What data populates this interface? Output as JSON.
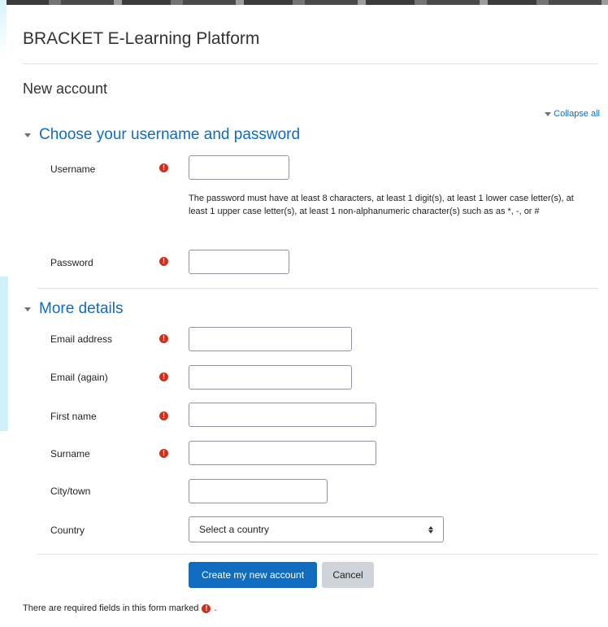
{
  "site": {
    "title": "BRACKET E-Learning Platform"
  },
  "page": {
    "heading": "New account"
  },
  "form": {
    "collapse_all": "Collapse all",
    "section_username": {
      "title": "Choose your username and password",
      "username_label": "Username",
      "password_help": "The password must have at least 8 characters, at least 1 digit(s), at least 1 lower case letter(s), at least 1 upper case letter(s), at least 1 non-alphanumeric character(s) such as as *, -, or #",
      "password_label": "Password"
    },
    "section_details": {
      "title": "More details",
      "email_label": "Email address",
      "email2_label": "Email (again)",
      "firstname_label": "First name",
      "surname_label": "Surname",
      "city_label": "City/town",
      "country_label": "Country",
      "country_selected": "Select a country"
    },
    "buttons": {
      "submit": "Create my new account",
      "cancel": "Cancel"
    },
    "required_note": "There are required fields in this form marked",
    "required_note_end": ".",
    "required_icon_glyph": "!"
  },
  "colors": {
    "accent": "#0f6cbf",
    "required": "#ca3120"
  },
  "icons": {
    "required": "exclamation-circle-icon",
    "collapse": "caret-down-icon",
    "select": "sort-updown-icon"
  }
}
